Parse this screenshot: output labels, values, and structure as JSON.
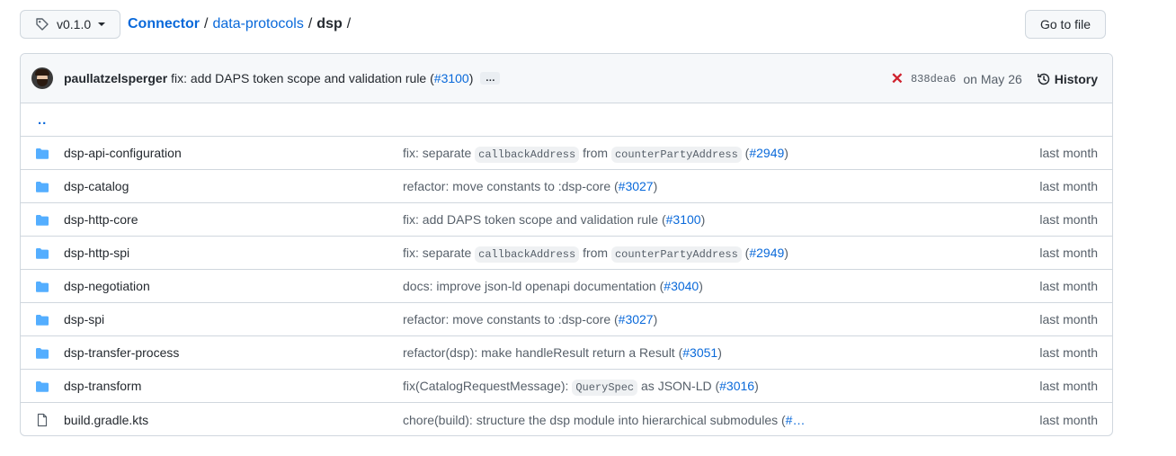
{
  "branch": {
    "label": "v0.1.0",
    "icon": "tag-icon"
  },
  "breadcrumb": {
    "repo": "Connector",
    "sep1": "/",
    "part1": "data-protocols",
    "sep2": "/",
    "current": "dsp",
    "sep3": "/"
  },
  "goto_file": "Go to file",
  "commit": {
    "author": "paullatzelsperger",
    "message": "fix: add DAPS token scope and validation rule (",
    "pr": "#3100",
    "message_end": ")",
    "more": "…",
    "status_icon": "✕",
    "sha": "838dea6",
    "date": "on May 26",
    "history_label": "History"
  },
  "parent_dir": "..",
  "rows": [
    {
      "type": "folder",
      "name": "dsp-api-configuration",
      "msg_parts": [
        "fix: separate ",
        "callbackAddress",
        " from ",
        "counterPartyAddress",
        " ("
      ],
      "pr": "#2949",
      "end": ")",
      "when": "last month"
    },
    {
      "type": "folder",
      "name": "dsp-catalog",
      "msg": "refactor: move constants to :dsp-core (",
      "pr": "#3027",
      "end": ")",
      "when": "last month"
    },
    {
      "type": "folder",
      "name": "dsp-http-core",
      "msg": "fix: add DAPS token scope and validation rule (",
      "pr": "#3100",
      "end": ")",
      "when": "last month"
    },
    {
      "type": "folder",
      "name": "dsp-http-spi",
      "msg_parts": [
        "fix: separate ",
        "callbackAddress",
        " from ",
        "counterPartyAddress",
        " ("
      ],
      "pr": "#2949",
      "end": ")",
      "when": "last month"
    },
    {
      "type": "folder",
      "name": "dsp-negotiation",
      "msg": "docs: improve json-ld openapi documentation (",
      "pr": "#3040",
      "end": ")",
      "when": "last month"
    },
    {
      "type": "folder",
      "name": "dsp-spi",
      "msg": "refactor: move constants to :dsp-core (",
      "pr": "#3027",
      "end": ")",
      "when": "last month"
    },
    {
      "type": "folder",
      "name": "dsp-transfer-process",
      "msg": "refactor(dsp): make handleResult return a Result (",
      "pr": "#3051",
      "end": ")",
      "when": "last month"
    },
    {
      "type": "folder",
      "name": "dsp-transform",
      "msg_parts": [
        "fix(CatalogRequestMessage): ",
        "QuerySpec",
        " as JSON-LD ("
      ],
      "pr": "#3016",
      "end": ")",
      "when": "last month"
    },
    {
      "type": "file",
      "name": "build.gradle.kts",
      "msg": "chore(build): structure the dsp module into hierarchical submodules (",
      "pr": "#…",
      "end": "",
      "when": "last month"
    }
  ],
  "colors": {
    "link": "#0969da",
    "folder": "#54aeff",
    "error": "#cf222e"
  }
}
